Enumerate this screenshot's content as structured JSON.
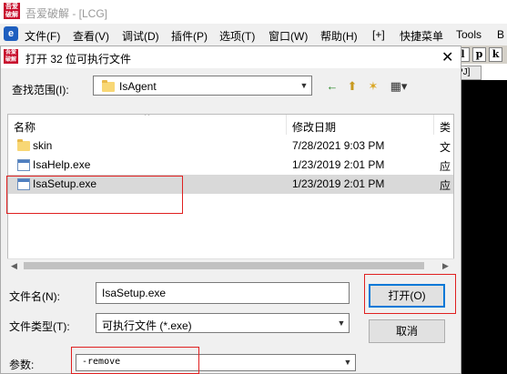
{
  "app": {
    "logo_text": "吾爱破解",
    "title": "吾爱破解 - [LCG]",
    "menu": [
      "文件(F)",
      "查看(V)",
      "调试(D)",
      "插件(P)",
      "选项(T)",
      "窗口(W)",
      "帮助(H)",
      "[+]",
      "快捷菜单",
      "Tools",
      "B"
    ],
    "toolbar_buttons": [
      "l",
      "p",
      "k"
    ],
    "toolbar_strip": "PJ]"
  },
  "dialog": {
    "title": "打开 32 位可执行文件",
    "close": "✕",
    "lookin_label": "查找范围(I):",
    "lookin_value": "IsAgent",
    "nav_icons": {
      "back": "←",
      "up": "⬆",
      "newfolder": "✶",
      "view": "▦▾"
    },
    "columns": {
      "name": "名称",
      "date": "修改日期",
      "type": "类"
    },
    "files": [
      {
        "name": "skin",
        "date": "7/28/2021 9:03 PM",
        "type": "文",
        "kind": "folder"
      },
      {
        "name": "IsaHelp.exe",
        "date": "1/23/2019 2:01 PM",
        "type": "应",
        "kind": "exe"
      },
      {
        "name": "IsaSetup.exe",
        "date": "1/23/2019 2:01 PM",
        "type": "应",
        "kind": "exe",
        "selected": true
      }
    ],
    "filename_label": "文件名(N):",
    "filename_value": "IsaSetup.exe",
    "filetype_label": "文件类型(T):",
    "filetype_value": "可执行文件 (*.exe)",
    "args_label": "参数:",
    "args_value": "-remove",
    "open_button": "打开(O)",
    "cancel_button": "取消"
  },
  "colors": {
    "annotation": "#e02020",
    "selection": "#d9d9d9",
    "focus": "#0078d7"
  }
}
